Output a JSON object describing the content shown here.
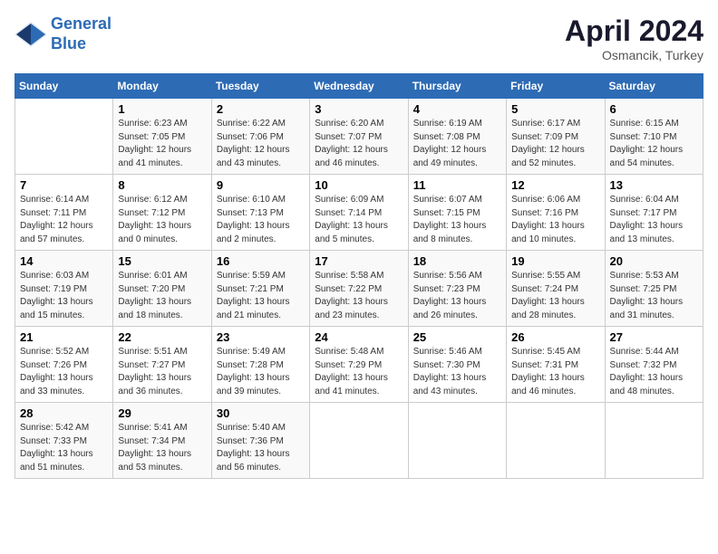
{
  "header": {
    "logo_line1": "General",
    "logo_line2": "Blue",
    "month": "April 2024",
    "location": "Osmancik, Turkey"
  },
  "days_of_week": [
    "Sunday",
    "Monday",
    "Tuesday",
    "Wednesday",
    "Thursday",
    "Friday",
    "Saturday"
  ],
  "weeks": [
    [
      {
        "num": "",
        "info": ""
      },
      {
        "num": "1",
        "info": "Sunrise: 6:23 AM\nSunset: 7:05 PM\nDaylight: 12 hours\nand 41 minutes."
      },
      {
        "num": "2",
        "info": "Sunrise: 6:22 AM\nSunset: 7:06 PM\nDaylight: 12 hours\nand 43 minutes."
      },
      {
        "num": "3",
        "info": "Sunrise: 6:20 AM\nSunset: 7:07 PM\nDaylight: 12 hours\nand 46 minutes."
      },
      {
        "num": "4",
        "info": "Sunrise: 6:19 AM\nSunset: 7:08 PM\nDaylight: 12 hours\nand 49 minutes."
      },
      {
        "num": "5",
        "info": "Sunrise: 6:17 AM\nSunset: 7:09 PM\nDaylight: 12 hours\nand 52 minutes."
      },
      {
        "num": "6",
        "info": "Sunrise: 6:15 AM\nSunset: 7:10 PM\nDaylight: 12 hours\nand 54 minutes."
      }
    ],
    [
      {
        "num": "7",
        "info": "Sunrise: 6:14 AM\nSunset: 7:11 PM\nDaylight: 12 hours\nand 57 minutes."
      },
      {
        "num": "8",
        "info": "Sunrise: 6:12 AM\nSunset: 7:12 PM\nDaylight: 13 hours\nand 0 minutes."
      },
      {
        "num": "9",
        "info": "Sunrise: 6:10 AM\nSunset: 7:13 PM\nDaylight: 13 hours\nand 2 minutes."
      },
      {
        "num": "10",
        "info": "Sunrise: 6:09 AM\nSunset: 7:14 PM\nDaylight: 13 hours\nand 5 minutes."
      },
      {
        "num": "11",
        "info": "Sunrise: 6:07 AM\nSunset: 7:15 PM\nDaylight: 13 hours\nand 8 minutes."
      },
      {
        "num": "12",
        "info": "Sunrise: 6:06 AM\nSunset: 7:16 PM\nDaylight: 13 hours\nand 10 minutes."
      },
      {
        "num": "13",
        "info": "Sunrise: 6:04 AM\nSunset: 7:17 PM\nDaylight: 13 hours\nand 13 minutes."
      }
    ],
    [
      {
        "num": "14",
        "info": "Sunrise: 6:03 AM\nSunset: 7:19 PM\nDaylight: 13 hours\nand 15 minutes."
      },
      {
        "num": "15",
        "info": "Sunrise: 6:01 AM\nSunset: 7:20 PM\nDaylight: 13 hours\nand 18 minutes."
      },
      {
        "num": "16",
        "info": "Sunrise: 5:59 AM\nSunset: 7:21 PM\nDaylight: 13 hours\nand 21 minutes."
      },
      {
        "num": "17",
        "info": "Sunrise: 5:58 AM\nSunset: 7:22 PM\nDaylight: 13 hours\nand 23 minutes."
      },
      {
        "num": "18",
        "info": "Sunrise: 5:56 AM\nSunset: 7:23 PM\nDaylight: 13 hours\nand 26 minutes."
      },
      {
        "num": "19",
        "info": "Sunrise: 5:55 AM\nSunset: 7:24 PM\nDaylight: 13 hours\nand 28 minutes."
      },
      {
        "num": "20",
        "info": "Sunrise: 5:53 AM\nSunset: 7:25 PM\nDaylight: 13 hours\nand 31 minutes."
      }
    ],
    [
      {
        "num": "21",
        "info": "Sunrise: 5:52 AM\nSunset: 7:26 PM\nDaylight: 13 hours\nand 33 minutes."
      },
      {
        "num": "22",
        "info": "Sunrise: 5:51 AM\nSunset: 7:27 PM\nDaylight: 13 hours\nand 36 minutes."
      },
      {
        "num": "23",
        "info": "Sunrise: 5:49 AM\nSunset: 7:28 PM\nDaylight: 13 hours\nand 39 minutes."
      },
      {
        "num": "24",
        "info": "Sunrise: 5:48 AM\nSunset: 7:29 PM\nDaylight: 13 hours\nand 41 minutes."
      },
      {
        "num": "25",
        "info": "Sunrise: 5:46 AM\nSunset: 7:30 PM\nDaylight: 13 hours\nand 43 minutes."
      },
      {
        "num": "26",
        "info": "Sunrise: 5:45 AM\nSunset: 7:31 PM\nDaylight: 13 hours\nand 46 minutes."
      },
      {
        "num": "27",
        "info": "Sunrise: 5:44 AM\nSunset: 7:32 PM\nDaylight: 13 hours\nand 48 minutes."
      }
    ],
    [
      {
        "num": "28",
        "info": "Sunrise: 5:42 AM\nSunset: 7:33 PM\nDaylight: 13 hours\nand 51 minutes."
      },
      {
        "num": "29",
        "info": "Sunrise: 5:41 AM\nSunset: 7:34 PM\nDaylight: 13 hours\nand 53 minutes."
      },
      {
        "num": "30",
        "info": "Sunrise: 5:40 AM\nSunset: 7:36 PM\nDaylight: 13 hours\nand 56 minutes."
      },
      {
        "num": "",
        "info": ""
      },
      {
        "num": "",
        "info": ""
      },
      {
        "num": "",
        "info": ""
      },
      {
        "num": "",
        "info": ""
      }
    ]
  ]
}
